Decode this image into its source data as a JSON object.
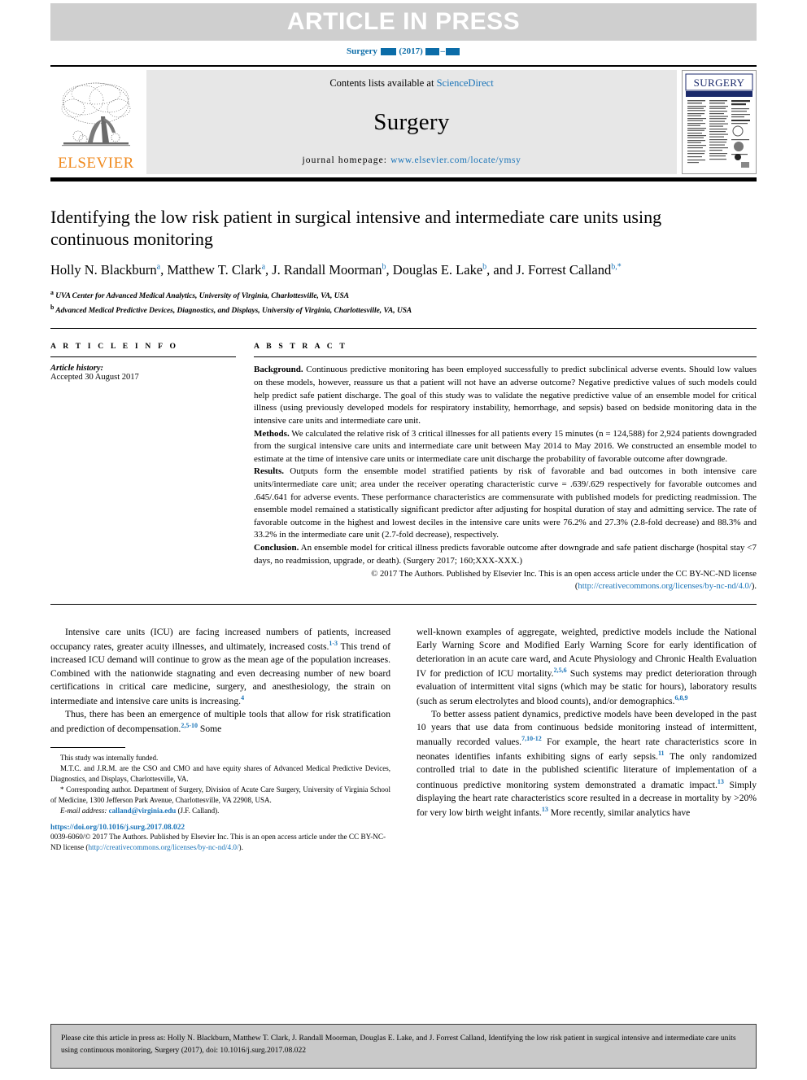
{
  "banner": {
    "text": "ARTICLE IN PRESS"
  },
  "running_head": {
    "journal": "Surgery",
    "year": "(2017)"
  },
  "masthead": {
    "publisher": "ELSEVIER",
    "contents_prefix": "Contents lists available at ",
    "contents_link": "ScienceDirect",
    "journal_name": "Surgery",
    "homepage_prefix": "journal homepage: ",
    "homepage_link": "www.elsevier.com/locate/ymsy",
    "cover_title": "SURGERY"
  },
  "article": {
    "title": "Identifying the low risk patient in surgical intensive and intermediate care units using continuous monitoring",
    "authors_line1": "Holly N. Blackburn ",
    "authors": [
      {
        "name": "Holly N. Blackburn",
        "sup": "a",
        "sep": ", "
      },
      {
        "name": "Matthew T. Clark",
        "sup": "a",
        "sep": ", "
      },
      {
        "name": "J. Randall Moorman",
        "sup": "b",
        "sep": ", "
      },
      {
        "name": "Douglas E. Lake",
        "sup": "b",
        "sep": ", and "
      },
      {
        "name": "J. Forrest Calland",
        "sup": "b,*",
        "sep": ""
      }
    ],
    "affiliations": [
      {
        "mark": "a",
        "text": "UVA Center for Advanced Medical Analytics, University of Virginia, Charlottesville, VA, USA"
      },
      {
        "mark": "b",
        "text": "Advanced Medical Predictive Devices, Diagnostics, and Displays, University of Virginia, Charlottesville, VA, USA"
      }
    ]
  },
  "article_info": {
    "heading": "A R T I C L E   I N F O",
    "history_label": "Article history:",
    "history_value": "Accepted 30 August 2017"
  },
  "abstract": {
    "heading": "A B S T R A C T",
    "background_label": "Background.",
    "background_text": "Continuous predictive monitoring has been employed successfully to predict subclinical adverse events. Should low values on these models, however, reassure us that a patient will not have an adverse outcome? Negative predictive values of such models could help predict safe patient discharge. The goal of this study was to validate the negative predictive value of an ensemble model for critical illness (using previously developed models for respiratory instability, hemorrhage, and sepsis) based on bedside monitoring data in the intensive care units and intermediate care unit.",
    "methods_label": "Methods.",
    "methods_text": "We calculated the relative risk of 3 critical illnesses for all patients every 15 minutes (n = 124,588) for 2,924 patients downgraded from the surgical intensive care units and intermediate care unit between May 2014 to May 2016. We constructed an ensemble model to estimate at the time of intensive care units or intermediate care unit discharge the probability of favorable outcome after downgrade.",
    "results_label": "Results.",
    "results_text": "Outputs form the ensemble model stratified patients by risk of favorable and bad outcomes in both intensive care units/intermediate care unit; area under the receiver operating characteristic curve = .639/.629 respectively for favorable outcomes and .645/.641 for adverse events. These performance characteristics are commensurate with published models for predicting readmission. The ensemble model remained a statistically significant predictor after adjusting for hospital duration of stay and admitting service. The rate of favorable outcome in the highest and lowest deciles in the intensive care units were 76.2% and 27.3% (2.8-fold decrease) and 88.3% and 33.2% in the intermediate care unit (2.7-fold decrease), respectively.",
    "conclusion_label": "Conclusion.",
    "conclusion_text": "An ensemble model for critical illness predicts favorable outcome after downgrade and safe patient discharge (hospital stay <7 days, no readmission, upgrade, or death). (Surgery 2017; 160;XXX-XXX.)",
    "copyright": "© 2017 The Authors. Published by Elsevier Inc. This is an open access article under the CC BY-NC-ND license (",
    "copyright_link": "http://creativecommons.org/licenses/by-nc-nd/4.0/",
    "copyright_suffix": ")."
  },
  "body": {
    "left_p1_a": "Intensive care units (ICU) are facing increased numbers of patients, increased occupancy rates, greater acuity illnesses, and ultimately, increased costs.",
    "left_p1_sup1": "1-3",
    "left_p1_b": " This trend of increased ICU demand will continue to grow as the mean age of the population increases. Combined with the nationwide stagnating and even decreasing number of new board certifications in critical care medicine, surgery, and anesthesiology, the strain on intermediate and intensive care units is increasing.",
    "left_p1_sup2": "4",
    "left_p2_a": "Thus, there has been an emergence of multiple tools that allow for risk stratification and prediction of decompensation.",
    "left_p2_sup": "2,5-10",
    "left_p2_b": " Some",
    "right_p1_a": "well-known examples of aggregate, weighted, predictive models include the National Early Warning Score and Modified Early Warning Score for early identification of deterioration in an acute care ward, and Acute Physiology and Chronic Health Evaluation IV for prediction of ICU mortality.",
    "right_p1_sup1": "2,5,6",
    "right_p1_b": " Such systems may predict deterioration through evaluation of intermittent vital signs (which may be static for hours), laboratory results (such as serum electrolytes and blood counts), and/or demographics.",
    "right_p1_sup2": "6,8,9",
    "right_p2_a": "To better assess patient dynamics, predictive models have been developed in the past 10 years that use data from continuous bedside monitoring instead of intermittent, manually recorded values.",
    "right_p2_sup1": "7,10-12",
    "right_p2_b": " For example, the heart rate characteristics score in neonates identifies infants exhibiting signs of early sepsis.",
    "right_p2_sup2": "11",
    "right_p2_c": " The only randomized controlled trial to date in the published scientific literature of implementation of a continuous predictive monitoring system demonstrated a dramatic impact.",
    "right_p2_sup3": "13",
    "right_p2_d": " Simply displaying the heart rate characteristics score resulted in a decrease in mortality by >20% for very low birth weight infants.",
    "right_p2_sup4": "13",
    "right_p2_e": " More recently, similar analytics have"
  },
  "footnotes": {
    "funding": "This study was internally funded.",
    "conflict": "M.T.C. and J.R.M. are the CSO and CMO and have equity shares of Advanced Medical Predictive Devices, Diagnostics, and Displays, Charlottesville, VA.",
    "corresponding_mark": "*",
    "corresponding": "Corresponding author. Department of Surgery, Division of Acute Care Surgery, University of Virginia School of Medicine, 1300 Jefferson Park Avenue, Charlottesville, VA 22908, USA.",
    "email_label": "E-mail address:",
    "email": "calland@virginia.edu",
    "email_suffix": "(J.F. Calland).",
    "doi": "https://doi.org/10.1016/j.surg.2017.08.022",
    "issn_a": "0039-6060/© 2017 The Authors. Published by Elsevier Inc. This is an open access article under the CC BY-NC-ND license (",
    "issn_link": "http://creativecommons.org/licenses/by-nc-nd/4.0/",
    "issn_b": ")."
  },
  "citation_box": {
    "text": "Please cite this article in press as: Holly N. Blackburn, Matthew T. Clark, J. Randall Moorman, Douglas E. Lake, and J. Forrest Calland, Identifying the low risk patient in surgical intensive and intermediate care units using continuous monitoring, Surgery (2017), doi: 10.1016/j.surg.2017.08.022"
  },
  "colors": {
    "link": "#1a74b8",
    "elsevier_orange": "#f08a1e",
    "banner_gray": "#cfcfcf",
    "masthead_gray": "#e7e7e7",
    "cite_gray": "#c9c9c9"
  }
}
